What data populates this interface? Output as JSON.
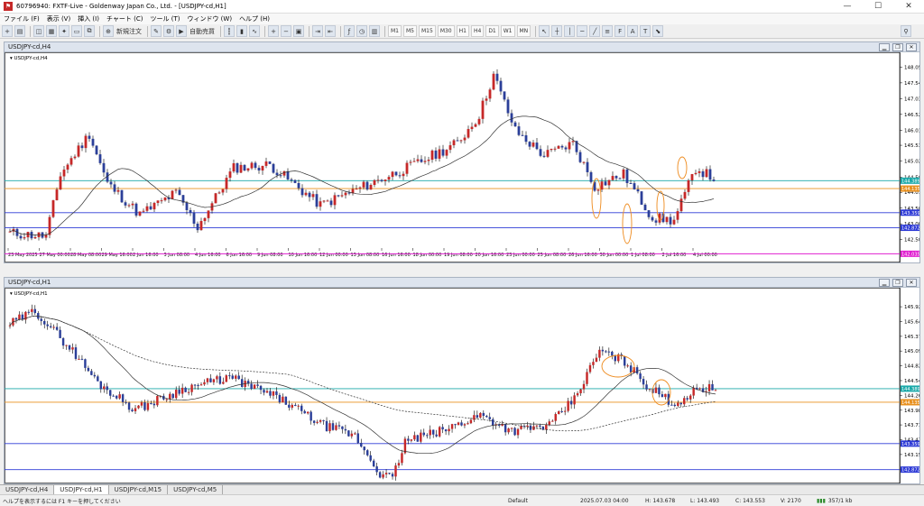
{
  "window": {
    "title": "60796940: FXTF-Live - Goldenway Japan Co., Ltd. - [USDJPY-cd,H1]",
    "controls": [
      "—",
      "☐",
      "✕"
    ]
  },
  "menu": [
    "ファイル (F)",
    "表示 (V)",
    "挿入 (I)",
    "チャート (C)",
    "ツール (T)",
    "ウィンドウ (W)",
    "ヘルプ (H)"
  ],
  "toolbar": {
    "new_order": "新規注文",
    "auto_trade": "自動売買",
    "timeframes": [
      "M1",
      "M5",
      "M15",
      "M30",
      "H1",
      "H4",
      "D1",
      "W1",
      "MN"
    ],
    "search_icon": "search-icon"
  },
  "chart_h4": {
    "window_title": "USDJPY-cd,H4",
    "symbol_label": "USDJPY-cd,H4",
    "ylim": [
      142.22,
      148.35
    ],
    "price_ticks": [
      "148.050",
      "147.540",
      "147.030",
      "146.525",
      "146.015",
      "145.530",
      "145.020",
      "144.500",
      "144.015",
      "143.505",
      "143.000",
      "142.500"
    ],
    "time_labels": [
      "23 May 2025",
      "27 May 00:00",
      "28 May 08:00",
      "29 May 16:00",
      "2 Jun 16:00",
      "3 Jun 08:00",
      "4 Jun 16:00",
      "6 Jun 16:00",
      "9 Jun 08:00",
      "10 Jun 16:00",
      "12 Jun 00:00",
      "13 Jun 08:00",
      "16 Jun 16:00",
      "18 Jun 00:00",
      "19 Jun 08:00",
      "20 Jun 16:00",
      "23 Jun 00:00",
      "25 Jun 08:00",
      "26 Jun 16:00",
      "30 Jun 00:00",
      "1 Jul 08:00",
      "2 Jul 16:00",
      "4 Jul 00:00"
    ],
    "hlines": [
      {
        "price": 144.389,
        "label": "144.389",
        "color": "#1aa9a9"
      },
      {
        "price": 144.135,
        "label": "144.135",
        "color": "#e8901e"
      },
      {
        "price": 143.359,
        "label": "143.359",
        "color": "#2e3bd6"
      },
      {
        "price": 142.872,
        "label": "142.872",
        "color": "#2e3bd6"
      },
      {
        "price": 142.035,
        "label": "142.035",
        "color": "#e020d0"
      }
    ]
  },
  "chart_h1": {
    "window_title": "USDJPY-cd,H1",
    "symbol_label": "USDJPY-cd,H1",
    "ylim": [
      142.68,
      146.18
    ],
    "price_ticks": [
      "145.925",
      "145.645",
      "145.370",
      "145.095",
      "144.820",
      "144.540",
      "144.265",
      "143.985",
      "143.710",
      "143.430",
      "143.155",
      "142.880"
    ],
    "hlines": [
      {
        "price": 144.389,
        "label": "144.389",
        "color": "#1aa9a9"
      },
      {
        "price": 144.135,
        "label": "144.135",
        "color": "#e8901e"
      },
      {
        "price": 143.359,
        "label": "143.359",
        "color": "#2e3bd6"
      },
      {
        "price": 142.872,
        "label": "142.872",
        "color": "#2e3bd6"
      }
    ]
  },
  "tabs": [
    "USDJPY-cd,H4",
    "USDJPY-cd,H1",
    "USDJPY-cd,M15",
    "USDJPY-cd,M5"
  ],
  "status": {
    "help": "ヘルプを表示するには F1 キーを押してください",
    "profile": "Default",
    "datetime": "2025.07.03 04:00",
    "high": "H: 143.678",
    "low": "L: 143.493",
    "close": "C: 143.553",
    "volume": "V: 2170",
    "traffic": "357/1 kb"
  },
  "colors": {
    "bull": "#c62828",
    "bear": "#2b3f99",
    "ma": "#333333"
  }
}
